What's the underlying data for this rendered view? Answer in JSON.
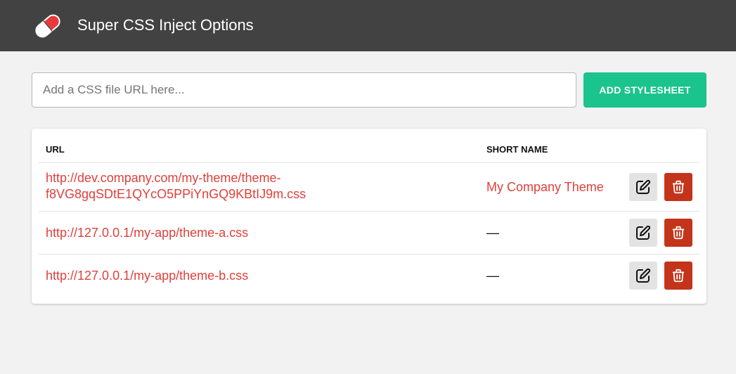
{
  "header": {
    "title": "Super CSS Inject Options",
    "logo_icon": "pill-icon"
  },
  "add_form": {
    "placeholder": "Add a CSS file URL here...",
    "value": "",
    "button_label": "ADD STYLESHEET"
  },
  "table": {
    "headers": {
      "url": "URL",
      "short_name": "SHORT NAME"
    },
    "rows": [
      {
        "url_line1": "http://dev.company.com/my-theme/theme-",
        "url_line2": "f8VG8gqSDtE1QYcO5PPiYnGQ9KBtIJ9m.css",
        "short_name": "My Company Theme"
      },
      {
        "url_line1": "http://127.0.0.1/my-app/theme-a.css",
        "short_name": "—"
      },
      {
        "url_line1": "http://127.0.0.1/my-app/theme-b.css",
        "short_name": "—"
      }
    ]
  },
  "colors": {
    "header_bg": "#424242",
    "accent_green": "#1bc48c",
    "link_red": "#e0403a",
    "delete_red": "#c3341b"
  }
}
